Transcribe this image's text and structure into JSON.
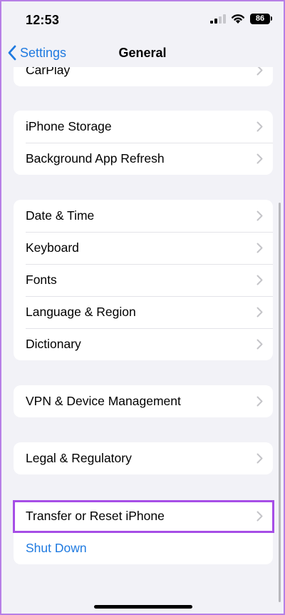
{
  "status_bar": {
    "time": "12:53",
    "battery": "86"
  },
  "nav": {
    "back_label": "Settings",
    "title": "General"
  },
  "groups": [
    {
      "rows": [
        "CarPlay"
      ]
    },
    {
      "rows": [
        "iPhone Storage",
        "Background App Refresh"
      ]
    },
    {
      "rows": [
        "Date & Time",
        "Keyboard",
        "Fonts",
        "Language & Region",
        "Dictionary"
      ]
    },
    {
      "rows": [
        "VPN & Device Management"
      ]
    },
    {
      "rows": [
        "Legal & Regulatory"
      ]
    },
    {
      "rows": [
        "Transfer or Reset iPhone",
        "Shut Down"
      ]
    }
  ],
  "colors": {
    "accent": "#1f7ae0",
    "highlight": "#a64ee6",
    "background": "#f2f2f7"
  }
}
